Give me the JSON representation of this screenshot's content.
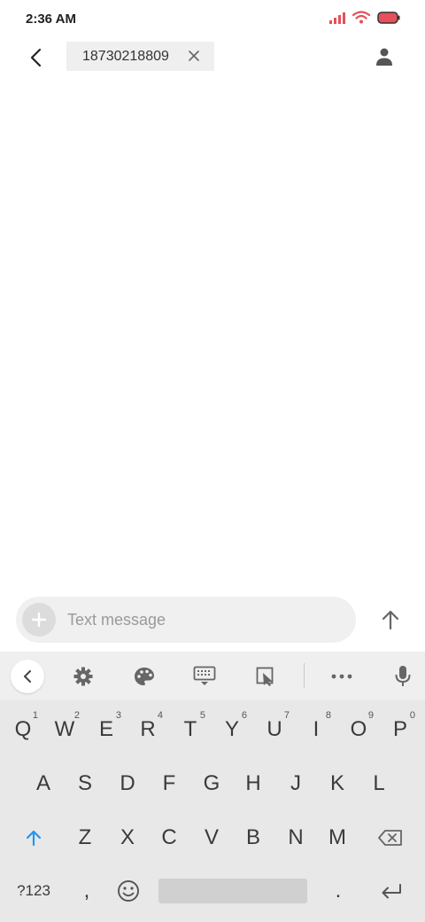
{
  "status_bar": {
    "time": "2:36 AM",
    "icons": [
      "signal-icon",
      "wifi-icon",
      "battery-icon"
    ],
    "accent_color": "#e5505a"
  },
  "header": {
    "back_icon": "back-arrow-icon",
    "recipient": "18730218809",
    "chip_close_icon": "close-icon",
    "contact_icon": "person-icon"
  },
  "compose": {
    "placeholder": "Text message",
    "value": "",
    "attach_icon": "plus-icon",
    "send_icon": "send-arrow-icon"
  },
  "keyboard": {
    "toolbar": [
      "collapse-icon",
      "gear-icon",
      "palette-icon",
      "keyboard-icon",
      "resize-icon",
      "more-icon",
      "mic-icon"
    ],
    "row1": [
      {
        "label": "Q",
        "hint": "1"
      },
      {
        "label": "W",
        "hint": "2"
      },
      {
        "label": "E",
        "hint": "3"
      },
      {
        "label": "R",
        "hint": "4"
      },
      {
        "label": "T",
        "hint": "5"
      },
      {
        "label": "Y",
        "hint": "6"
      },
      {
        "label": "U",
        "hint": "7"
      },
      {
        "label": "I",
        "hint": "8"
      },
      {
        "label": "O",
        "hint": "9"
      },
      {
        "label": "P",
        "hint": "0"
      }
    ],
    "row2": [
      "A",
      "S",
      "D",
      "F",
      "G",
      "H",
      "J",
      "K",
      "L"
    ],
    "row3": [
      "Z",
      "X",
      "C",
      "V",
      "B",
      "N",
      "M"
    ],
    "symbols_label": "?123",
    "comma_label": ",",
    "period_label": ".",
    "shift_color": "#2196f3"
  }
}
